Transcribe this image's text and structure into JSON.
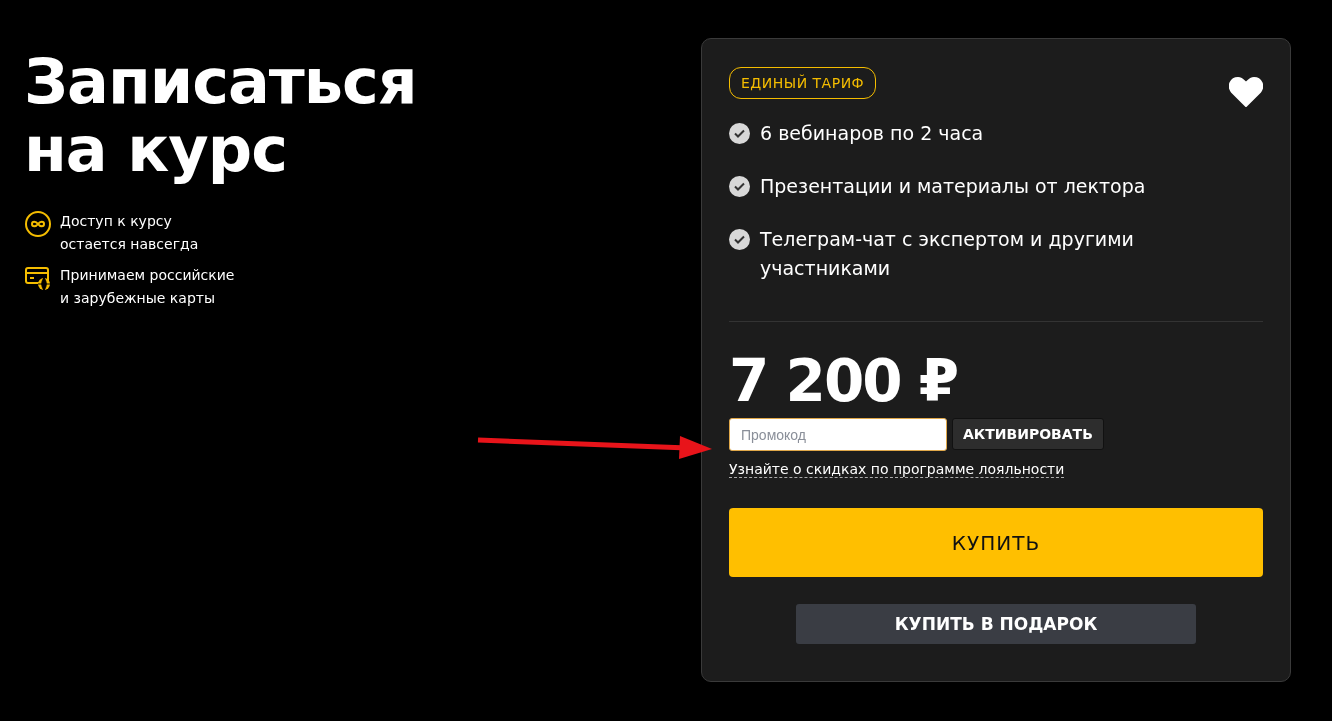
{
  "heading": [
    "Записаться",
    "на курс"
  ],
  "perks": [
    {
      "kind": "infinity",
      "lines": [
        "Доступ к курсу",
        "остается навсегда"
      ]
    },
    {
      "kind": "card",
      "lines": [
        "Принимаем российские",
        "и зарубежные карты"
      ]
    }
  ],
  "tariff": {
    "badge": "ЕДИНЫЙ ТАРИФ",
    "favorite": true,
    "features": [
      {
        "text": "6 вебинаров по 2 часа",
        "checked": true
      },
      {
        "text": "Презентации и материалы от лектора",
        "checked": true
      },
      {
        "text": "Телеграм-чат с экспертом и другими участниками",
        "checked": true
      }
    ],
    "price": "7 200 ₽",
    "promo": {
      "placeholder": "Промокод",
      "button": "АКТИВИРОВАТЬ"
    },
    "loyalty_link": "Узнайте о скидках по программе лояльности",
    "buy": "КУПИТЬ",
    "gift": "КУПИТЬ В ПОДАРОК"
  },
  "annotation": {
    "kind": "arrow"
  }
}
